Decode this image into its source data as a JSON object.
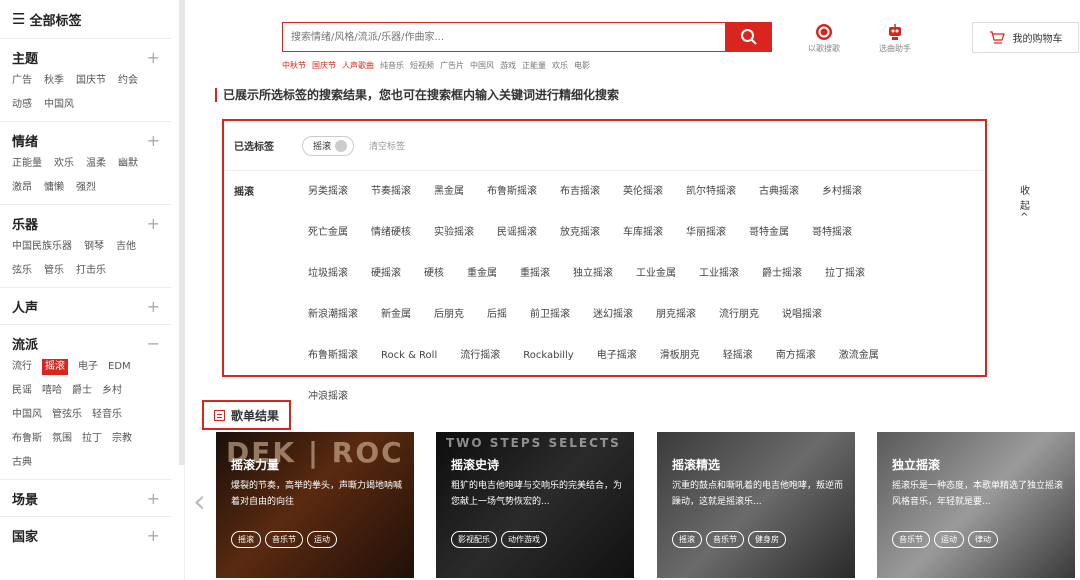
{
  "sidebar": {
    "header": "全部标签",
    "groups": [
      {
        "title": "主题",
        "toggle": "+",
        "tags": [
          "广告",
          "秋季",
          "国庆节",
          "约会",
          "动感",
          "中国风"
        ]
      },
      {
        "title": "情绪",
        "toggle": "+",
        "tags": [
          "正能量",
          "欢乐",
          "温柔",
          "幽默",
          "激昂",
          "慵懒",
          "强烈"
        ]
      },
      {
        "title": "乐器",
        "toggle": "+",
        "tags": [
          "中国民族乐器",
          "钢琴",
          "吉他",
          "弦乐",
          "管乐",
          "打击乐"
        ]
      },
      {
        "title": "人声",
        "toggle": "+",
        "tags": []
      },
      {
        "title": "流派",
        "toggle": "−",
        "tags": [
          "流行",
          "摇滚",
          "电子",
          "EDM",
          "民谣",
          "嘻哈",
          "爵士",
          "乡村",
          "中国风",
          "管弦乐",
          "轻音乐",
          "布鲁斯",
          "氛围",
          "拉丁",
          "宗教",
          "古典"
        ],
        "active": "摇滚"
      },
      {
        "title": "场景",
        "toggle": "+",
        "tags": []
      },
      {
        "title": "国家",
        "toggle": "+",
        "tags": []
      }
    ]
  },
  "search": {
    "placeholder": "搜索情绪/风格/流派/乐器/作曲家...",
    "hot": [
      "中秋节",
      "国庆节",
      "人声歌曲",
      "纯音乐",
      "短视频",
      "广告片",
      "中国风",
      "游戏",
      "正能量",
      "欢乐",
      "电影"
    ],
    "hot_red_count": 3
  },
  "tools": {
    "listen": "以歌搜歌",
    "helper": "选曲助手"
  },
  "cart": {
    "label": "我的购物车"
  },
  "notice": "已展示所选标签的搜索结果，您也可在搜索框内输入关键词进行精细化搜索",
  "filter": {
    "selected_label": "已选标签",
    "selected_chip": "摇滚",
    "clear_label": "清空标签",
    "category": "摇滚",
    "collapse": "收起 ^",
    "tags": [
      "另类摇滚",
      "节奏摇滚",
      "黑金属",
      "布鲁斯摇滚",
      "布吉摇滚",
      "英伦摇滚",
      "凯尔特摇滚",
      "古典摇滚",
      "乡村摇滚",
      "死亡金属",
      "情绪硬核",
      "实验摇滚",
      "民谣摇滚",
      "放克摇滚",
      "车库摇滚",
      "华丽摇滚",
      "哥特金属",
      "哥特摇滚",
      "垃圾摇滚",
      "硬摇滚",
      "硬核",
      "重金属",
      "重摇滚",
      "独立摇滚",
      "工业金属",
      "工业摇滚",
      "爵士摇滚",
      "拉丁摇滚",
      "新浪潮摇滚",
      "新金属",
      "后朋克",
      "后摇",
      "前卫摇滚",
      "迷幻摇滚",
      "朋克摇滚",
      "流行朋克",
      "说唱摇滚",
      "布鲁斯摇滚",
      "Rock & Roll",
      "流行摇滚",
      "Rockabilly",
      "电子摇滚",
      "滑板朋克",
      "轻摇滚",
      "南方摇滚",
      "激流金属",
      "冲浪摇滚"
    ]
  },
  "playlists": {
    "heading": "歌单结果",
    "items": [
      {
        "title": "摇滚力量",
        "desc": "爆裂的节奏，高举的拳头，声嘶力竭地呐喊着对自由的向往",
        "tags": [
          "摇滚",
          "音乐节",
          "运动"
        ],
        "bg_text": "DEK | ROC"
      },
      {
        "title": "摇滚史诗",
        "desc": "粗犷的电吉他咆哮与交响乐的完美结合，为您献上一场气势恢宏的...",
        "tags": [
          "影视配乐",
          "动作游戏"
        ],
        "bg_text": "TWO STEPS SELECTS"
      },
      {
        "title": "摇滚精选",
        "desc": "沉重的鼓点和嘶吼着的电吉他咆哮，叛逆而躁动，这就是摇滚乐...",
        "tags": [
          "摇滚",
          "音乐节",
          "健身房"
        ],
        "bg_text": ""
      },
      {
        "title": "独立摇滚",
        "desc": "摇滚乐是一种态度，本歌单精选了独立摇滚风格音乐，年轻就是要...",
        "tags": [
          "音乐节",
          "运动",
          "律动"
        ],
        "bg_text": ""
      }
    ]
  },
  "colors": {
    "accent": "#d8251d"
  }
}
